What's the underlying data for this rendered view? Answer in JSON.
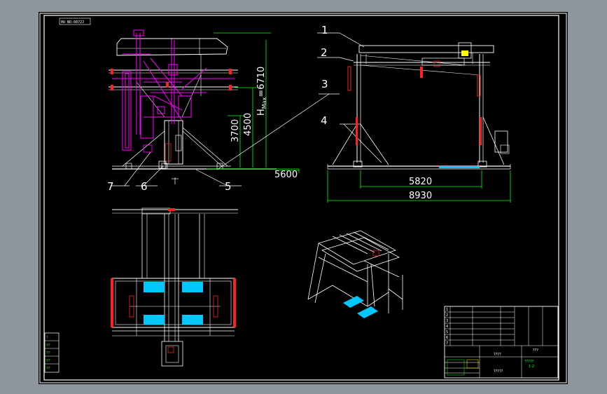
{
  "drawing": {
    "sheet_tag": "HU NO-0872J",
    "colors": {
      "background": "#000000",
      "frame": "#ffffff",
      "dimension": "#00ff00",
      "magenta": "#ff00ff",
      "red": "#ff2020",
      "cyan": "#00c8ff",
      "yellow": "#ffff00",
      "outside": "#8f979e"
    },
    "callouts": [
      "1",
      "2",
      "3",
      "4",
      "5",
      "6",
      "7"
    ],
    "dimensions": {
      "h_max": "H",
      "h_max_sub": "Max",
      "h_max_value": "=6710",
      "d4500": "4500",
      "d3700": "3700",
      "d5600": "5600",
      "d5820": "5820",
      "d8930": "8930"
    },
    "title_block": {
      "qmark_center": "????",
      "qmark_small": "???",
      "part_label": "?????",
      "ratio": "1:2",
      "bottom_label": "?????",
      "rows": [
        "1",
        "2",
        "3",
        "4",
        "5",
        "6",
        "7"
      ]
    },
    "side_stamp_labels": [
      "?",
      "??",
      "??",
      "??",
      "??"
    ]
  }
}
